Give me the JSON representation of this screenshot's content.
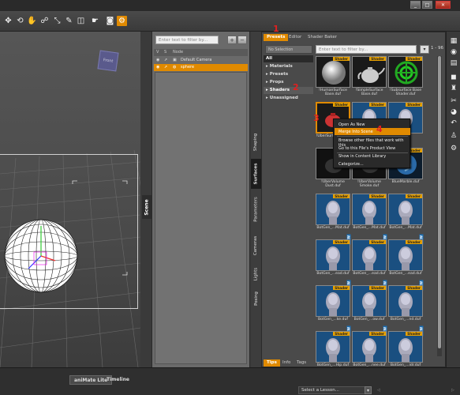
{
  "window": {
    "minimize": "_",
    "maximize": "□",
    "close": "✕"
  },
  "toolbar": {
    "icons": [
      "transform-icon",
      "universal-icon",
      "hand-icon",
      "pose-icon",
      "scale-icon",
      "joint-icon",
      "grab-icon",
      "select-icon",
      "camera-icon",
      "render-icon"
    ]
  },
  "viewport": {
    "cube_label": "Front"
  },
  "scene": {
    "tab_label": "Scene",
    "filter_placeholder": "Enter text to filter by...",
    "header": {
      "v": "V",
      "s": "S",
      "node": "Node"
    },
    "rows": [
      {
        "label": "Default Camera",
        "selected": false
      },
      {
        "label": "sphere",
        "selected": true
      }
    ],
    "add_button": "+",
    "remove_button": "−"
  },
  "side_tabs": [
    "Shaping",
    "Surfaces",
    "Parameters",
    "Cameras",
    "Lights",
    "Posing"
  ],
  "side_tab_active": "Surfaces",
  "content": {
    "top_tabs": [
      "Presets",
      "Editor",
      "Shader Baker"
    ],
    "active_tab": "Presets",
    "category_dropdown": "No Selection",
    "filter_placeholder": "Enter text to filter by...",
    "pager": "1 - 96",
    "categories": [
      {
        "label": "All",
        "type": "all"
      },
      {
        "label": "Materials",
        "type": "normal"
      },
      {
        "label": "Presets",
        "type": "normal"
      },
      {
        "label": "Props",
        "type": "normal"
      },
      {
        "label": "Shaders",
        "type": "selected"
      },
      {
        "label": "Unassigned",
        "type": "normal"
      }
    ],
    "thumbnails": [
      {
        "caption": "!HumanSurface Base.duf",
        "badge": "Shader"
      },
      {
        "caption": "!SimpleSurface Base.duf",
        "badge": "Shader"
      },
      {
        "caption": "!Subsurface Base Shader.duf",
        "badge": "Shader"
      },
      {
        "caption": "!UberSurface Base",
        "badge": "Shader"
      },
      {
        "caption": "",
        "badge": "Shader"
      },
      {
        "caption": "",
        "badge": "Shader"
      },
      {
        "caption": "!UberVolume Dust.duf",
        "badge": "Shader"
      },
      {
        "caption": "!UberVolume Smoke.duf",
        "badge": "Shader"
      },
      {
        "caption": "BlueMarble.duf",
        "badge": "Shader"
      },
      {
        "caption": "BotGen_...Mat.duf",
        "badge": "Shader"
      },
      {
        "caption": "BotGen_...Mat.duf",
        "badge": "Shader"
      },
      {
        "caption": "BotGen_...Mat.duf",
        "badge": "Shader"
      },
      {
        "caption": "BotGen_...ead.duf",
        "badge": "Shader"
      },
      {
        "caption": "BotGen_...ead.duf",
        "badge": "Shader"
      },
      {
        "caption": "BotGen_...ead.duf",
        "badge": "Shader"
      },
      {
        "caption": "BotGen_...ke.duf",
        "badge": "Shader"
      },
      {
        "caption": "BotGen_...ow.duf",
        "badge": "Shader"
      },
      {
        "caption": "BotGen_...nd.duf",
        "badge": "Shader"
      },
      {
        "caption": "BotGen_...Hip.duf",
        "badge": "Shader"
      },
      {
        "caption": "BotGen_...nee.duf",
        "badge": "Shader"
      },
      {
        "caption": "BotGen_...idr.duf",
        "badge": "Shader"
      }
    ],
    "new_tag": "NEW",
    "bottom_tabs": [
      "Tips",
      "Info",
      "Tags"
    ],
    "active_bottom_tab": "Tips"
  },
  "context_menu": {
    "items": [
      "Open As New",
      "Merge Into Scene",
      "Browse other files that work with this",
      "Go to this File's Product View",
      "Show in Content Library",
      "Categorize..."
    ],
    "highlighted": "Merge Into Scene"
  },
  "annotations": [
    "1",
    "2",
    "3",
    "4"
  ],
  "bottom_bar": {
    "tabs": [
      "aniMate Lite",
      "Timeline"
    ],
    "lesson_placeholder": "Select a Lesson..."
  },
  "right_strip": {
    "icons": [
      "smart-content-icon",
      "content-library-icon",
      "render-settings-icon",
      "tool-settings-icon",
      "figure-icon",
      "hair-icon",
      "shader-mixer-icon",
      "undo-icon",
      "pose-tool-icon",
      "node-icon"
    ]
  }
}
